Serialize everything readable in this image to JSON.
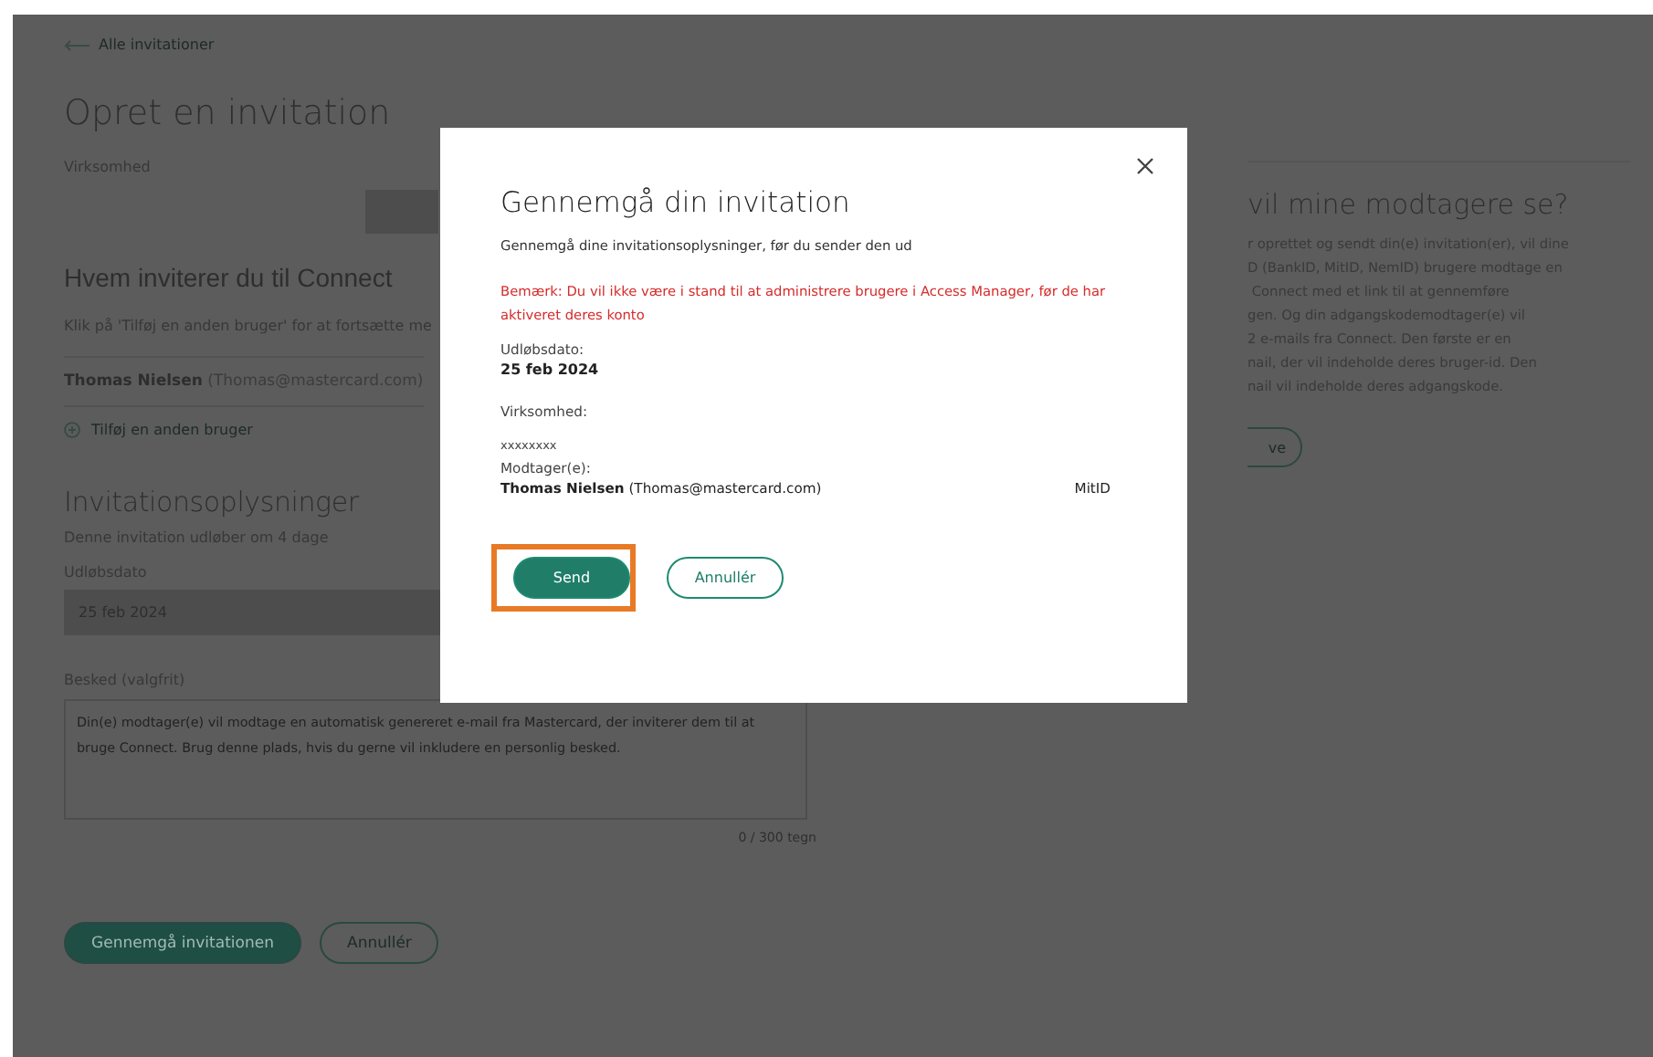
{
  "page": {
    "back_link": "Alle invitationer",
    "title": "Opret en invitation",
    "company_label": "Virksomhed",
    "who_heading": "Hvem inviterer du til Connect",
    "who_hint": "Klik på 'Tilføj en anden bruger' for at fortsætte me",
    "recipient": {
      "name": "Thomas Nielsen",
      "email": "(Thomas@mastercard.com)"
    },
    "add_user": "Tilføj en anden bruger",
    "info_heading": "Invitationsoplysninger",
    "expiry_note": "Denne invitation udløber om 4 dage",
    "expiry_label": "Udløbsdato",
    "expiry_value": "25 feb 2024",
    "message_label": "Besked (valgfrit)",
    "message_placeholder": "Din(e) modtager(e) vil modtage en automatisk genereret e-mail fra Mastercard, der inviterer dem til at bruge Connect. Brug denne plads, hvis du gerne vil inkludere en personlig besked.",
    "char_count": "0 / 300 tegn",
    "buttons": [
      {
        "label": "Gennemgå invitationen",
        "kind": "primary"
      },
      {
        "label": "Annullér",
        "kind": "secondary"
      }
    ]
  },
  "side_panel": {
    "heading": "vil mine modtagere se?",
    "lines": [
      "r oprettet og sendt din(e) invitation(er), vil dine",
      "D (BankID, MitID, NemID) brugere modtage en",
      " Connect med et link til at gennemføre",
      "gen. Og din adgangskodemodtager(e) vil",
      "2 e-mails fra Connect. Den første er en",
      "nail, der vil indeholde deres bruger-id. Den",
      "nail vil indeholde deres adgangskode."
    ],
    "button": "ve"
  },
  "dialog": {
    "title": "Gennemgå din invitation",
    "subtitle": "Gennemgå dine invitationsoplysninger, før du sender den ud",
    "warning": "Bemærk: Du vil ikke være i stand til at administrere brugere i Access Manager, før de har aktiveret deres konto",
    "expiry_label": "Udløbsdato:",
    "expiry_value": "25 feb 2024",
    "company_label": "Virksomhed:",
    "company_value": "xxxxxxxx",
    "recipients_label": "Modtager(e):",
    "recipients": [
      {
        "name": "Thomas Nielsen",
        "email": "(Thomas@mastercard.com)",
        "method": "MitID"
      }
    ],
    "buttons": [
      {
        "label": "Send",
        "kind": "primary",
        "highlighted": true
      },
      {
        "label": "Annullér",
        "kind": "secondary",
        "highlighted": false
      }
    ]
  }
}
